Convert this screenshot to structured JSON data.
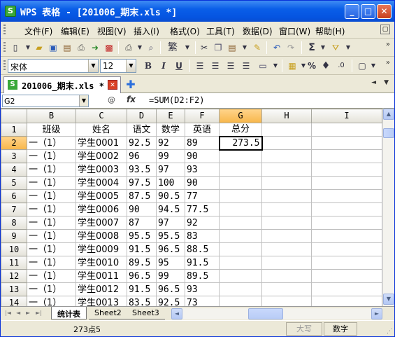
{
  "window": {
    "title": "WPS 表格 - [201006_期末.xls *]",
    "app_icon_letter": "S",
    "minimize": "_",
    "maximize": "□",
    "close": "✕"
  },
  "menu": {
    "items": [
      "文件(F)",
      "编辑(E)",
      "视图(V)",
      "插入(I)",
      "格式(O)",
      "工具(T)",
      "数据(D)",
      "窗口(W)",
      "帮助(H)"
    ],
    "restore_icon": "▢"
  },
  "toolbar_standard": {
    "icons": [
      "new-icon",
      "open-icon",
      "save-icon",
      "permission-icon",
      "print-preview-icon",
      "export-icon",
      "pdf-icon",
      "print-icon",
      "preview-icon",
      "traditional-icon",
      "cut-icon",
      "copy-icon",
      "paste-icon",
      "format-painter-icon",
      "undo-icon",
      "redo-icon",
      "sum-icon",
      "filter-icon"
    ],
    "traditional_label": "繁",
    "sum_label": "Σ"
  },
  "toolbar_format": {
    "font_name": "宋体",
    "font_size": "12",
    "bold": "B",
    "italic": "I",
    "underline": "U",
    "percent": "%",
    "comma": "♦"
  },
  "tabs": {
    "document_tab": "201006_期末.xls *",
    "doc_tab_icon": "S",
    "close": "✕",
    "new_tab": "✚"
  },
  "formula_bar": {
    "cell_ref": "G2",
    "zoom_icon": "@",
    "fx_label": "fx",
    "formula": "=SUM(D2:F2)"
  },
  "grid": {
    "columns": [
      "B",
      "C",
      "D",
      "E",
      "F",
      "G",
      "H",
      "I"
    ],
    "selected_column": "G",
    "rows": [
      {
        "num": "1",
        "cells": [
          "班级",
          "姓名",
          "语文",
          "数学",
          "英语",
          "总分",
          "",
          ""
        ]
      },
      {
        "num": "2",
        "cells": [
          "一（1）",
          "学生0001",
          "92.5",
          "92",
          "89",
          "273.5",
          "",
          ""
        ]
      },
      {
        "num": "3",
        "cells": [
          "一（1）",
          "学生0002",
          "96",
          "99",
          "90",
          "",
          "",
          ""
        ]
      },
      {
        "num": "4",
        "cells": [
          "一（1）",
          "学生0003",
          "93.5",
          "97",
          "93",
          "",
          "",
          ""
        ]
      },
      {
        "num": "5",
        "cells": [
          "一（1）",
          "学生0004",
          "97.5",
          "100",
          "90",
          "",
          "",
          ""
        ]
      },
      {
        "num": "6",
        "cells": [
          "一（1）",
          "学生0005",
          "87.5",
          "90.5",
          "77",
          "",
          "",
          ""
        ]
      },
      {
        "num": "7",
        "cells": [
          "一（1）",
          "学生0006",
          "90",
          "94.5",
          "77.5",
          "",
          "",
          ""
        ]
      },
      {
        "num": "8",
        "cells": [
          "一（1）",
          "学生0007",
          "87",
          "97",
          "92",
          "",
          "",
          ""
        ]
      },
      {
        "num": "9",
        "cells": [
          "一（1）",
          "学生0008",
          "95.5",
          "95.5",
          "83",
          "",
          "",
          ""
        ]
      },
      {
        "num": "10",
        "cells": [
          "一（1）",
          "学生0009",
          "91.5",
          "96.5",
          "88.5",
          "",
          "",
          ""
        ]
      },
      {
        "num": "11",
        "cells": [
          "一（1）",
          "学生0010",
          "89.5",
          "95",
          "91.5",
          "",
          "",
          ""
        ]
      },
      {
        "num": "12",
        "cells": [
          "一（1）",
          "学生0011",
          "96.5",
          "99",
          "89.5",
          "",
          "",
          ""
        ]
      },
      {
        "num": "13",
        "cells": [
          "一（1）",
          "学生0012",
          "91.5",
          "96.5",
          "93",
          "",
          "",
          ""
        ]
      },
      {
        "num": "14",
        "cells": [
          "一（1）",
          "学生0013",
          "83.5",
          "92.5",
          "73",
          "",
          "",
          ""
        ]
      }
    ]
  },
  "sheets": {
    "tabs": [
      "统计表",
      "Sheet2",
      "Sheet3"
    ],
    "active": "统计表"
  },
  "status": {
    "sum": "273点5",
    "caps": "大写",
    "num": "数字"
  }
}
